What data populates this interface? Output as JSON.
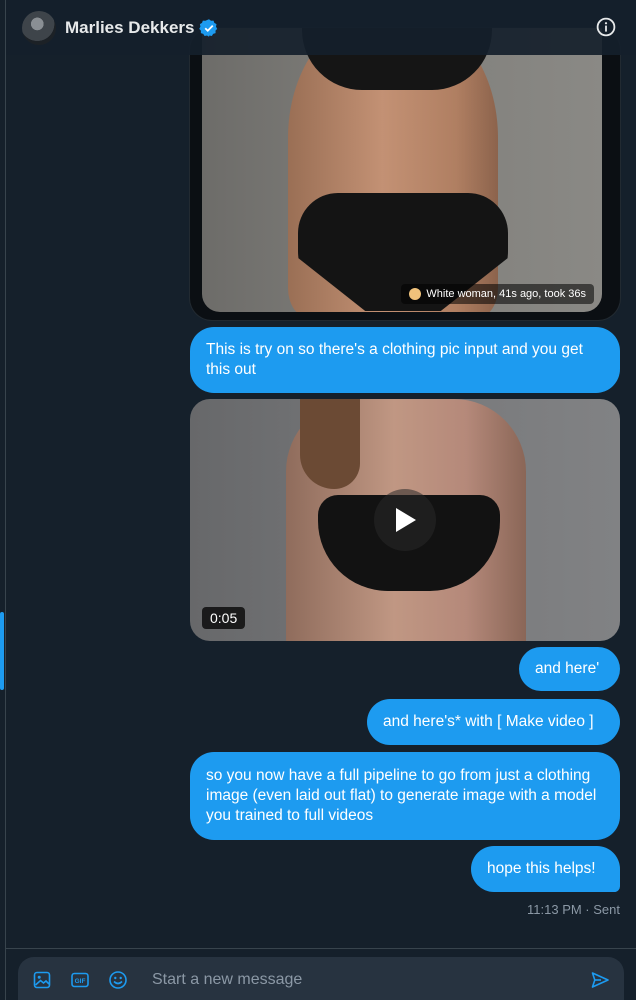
{
  "header": {
    "contact_name": "Marlies Dekkers",
    "avatar": "avatar",
    "verified_icon": "verified-badge-icon",
    "info_icon": "info-icon"
  },
  "messages": {
    "image_caption": "White woman, 41s ago, took 36s",
    "bubble_1": "This is try on so there's a clothing pic input and you get this out",
    "video_duration": "0:05",
    "bubble_2": "and here'",
    "bubble_3": "and here's* with [ Make video ]",
    "bubble_4": "so you now have a full pipeline to go from just a clothing image (even laid out flat) to generate image with a model you trained to full videos",
    "bubble_5": "hope this helps!",
    "status": "11:13 PM · Sent"
  },
  "composer": {
    "placeholder": "Start a new message",
    "icons": [
      "media-icon",
      "gif-icon",
      "emoji-icon",
      "send-icon"
    ]
  },
  "colors": {
    "background": "#15202b",
    "bubble": "#1d9bf0",
    "secondary_text": "#8b98a5",
    "composer": "#273340"
  }
}
